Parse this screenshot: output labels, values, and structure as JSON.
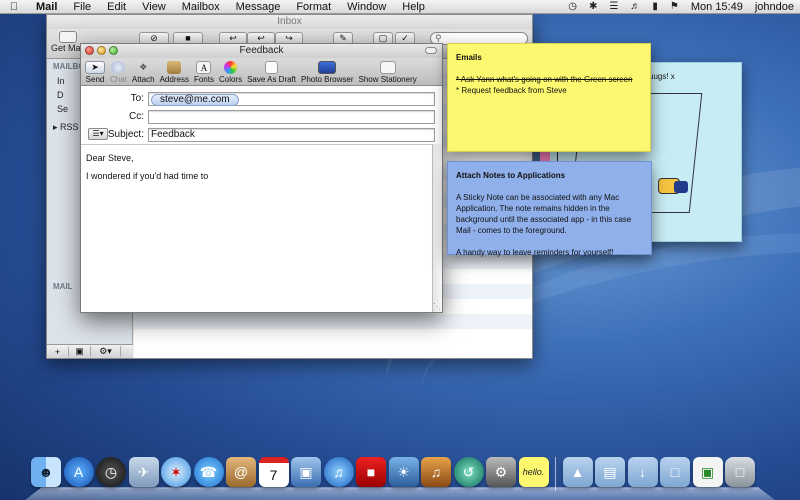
{
  "menubar": {
    "apple": "",
    "menus": [
      "Mail",
      "File",
      "Edit",
      "View",
      "Mailbox",
      "Message",
      "Format",
      "Window",
      "Help"
    ],
    "clock": "Mon 15:49",
    "user": "johndoe"
  },
  "mail_window": {
    "title": "Inbox",
    "get_mail": "Get Mail",
    "sidebar": {
      "mailboxes_header": "MAILBO",
      "rows": [
        "In",
        "D",
        "Se"
      ],
      "rss": "RSS",
      "mail_header": "MAIL"
    }
  },
  "compose": {
    "title": "Feedback",
    "toolbar": {
      "send": "Send",
      "chat": "Chat",
      "attach": "Attach",
      "address": "Address",
      "fonts": "Fonts",
      "colors": "Colors",
      "save_as_draft": "Save As Draft",
      "photo_browser": "Photo Browser",
      "show_stationery": "Show Stationery"
    },
    "to_label": "To:",
    "to_value": "steve@me.com",
    "cc_label": "Cc:",
    "cc_value": "",
    "subject_label": "Subject:",
    "subject_value": "Feedback",
    "body": {
      "line1": "Dear Steve,",
      "line2": "I wondered if you'd had time to"
    }
  },
  "sticky_emails": {
    "title": "Emails",
    "item1": "* Ask Yann what's going on with the Green screen",
    "item2": "* Request feedback from Steve",
    "color": "#fcf870"
  },
  "sticky_attach": {
    "title": "Attach Notes to Applications",
    "para1": "A Sticky Note can be associated with any Mac Application. The note remains hidden in the background until the associated app - in this case Mail - comes to the foreground.",
    "para2": "A handy way to leave reminders for yourself!",
    "color": "#8fb0ea"
  },
  "sticky_drawing": {
    "text": "uugs! x",
    "color": "#c7ecf4"
  },
  "dock": {
    "icons": [
      "finder",
      "app-store",
      "dashboard",
      "mail",
      "safari",
      "ichat",
      "address-book",
      "ical",
      "preview",
      "itunes",
      "photo-booth",
      "iphoto",
      "garageband",
      "time-machine",
      "system-preferences",
      "hello-sticky",
      "applications-folder",
      "documents-folder",
      "downloads-folder",
      "folder",
      "pdf-stack",
      "trash"
    ],
    "hello_label": "hello."
  }
}
